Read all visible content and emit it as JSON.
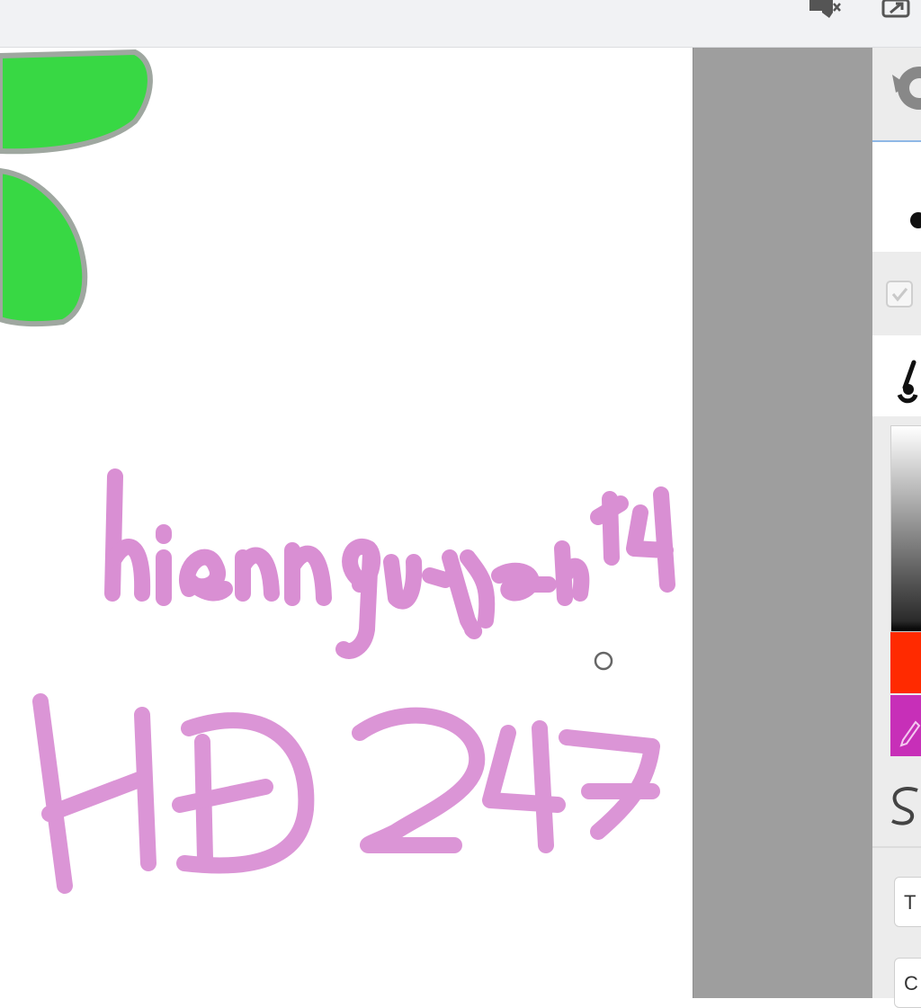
{
  "toolbar": {
    "icons": [
      "speaker-muted-icon",
      "share-external-icon"
    ]
  },
  "canvas": {
    "handwriting_line1": "hiennguyen114",
    "handwriting_line2": "HD247",
    "ink_color": "#d583cf",
    "leaf_color": "#2ed63a"
  },
  "panel": {
    "colors": {
      "red": "#ff2a00",
      "magenta": "#c72fb8"
    },
    "text_field_1": "T",
    "text_field_2": "C"
  }
}
